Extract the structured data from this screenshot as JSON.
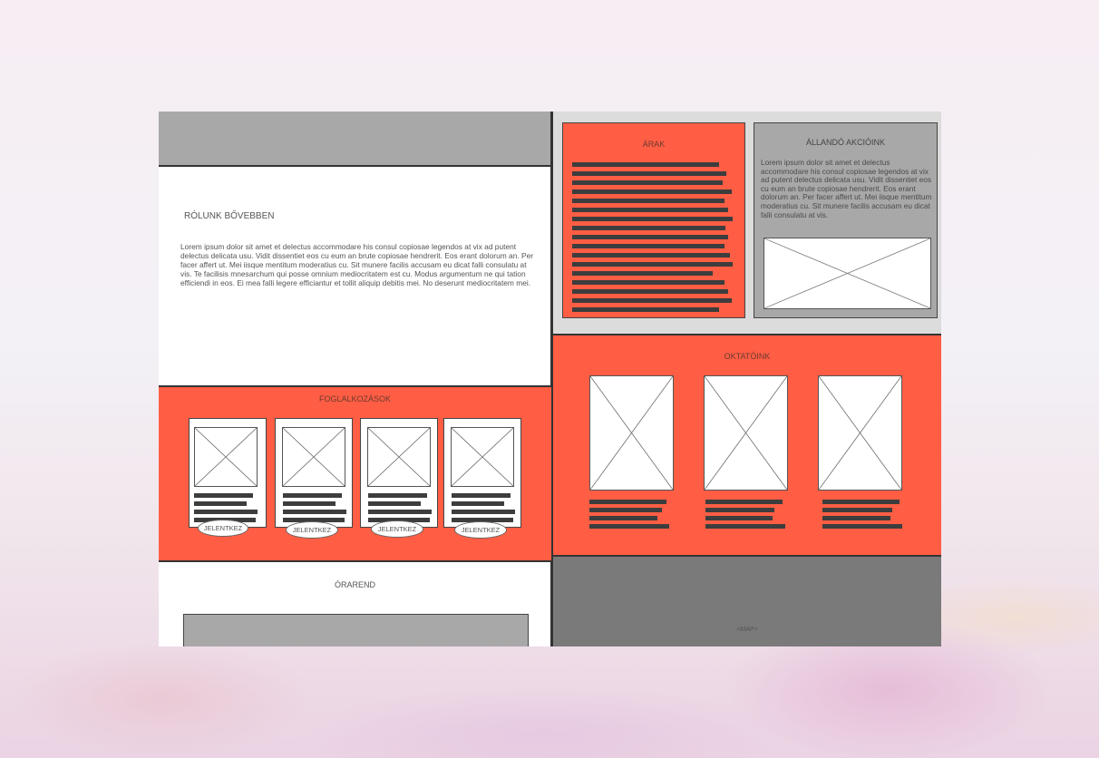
{
  "about": {
    "title": "RÓLUNK BŐVEBBEN",
    "text": "Lorem ipsum dolor sit amet et delectus accommodare his consul copiosae legendos at vix ad putent delectus delicata usu. Vidit dissentiet eos cu eum an brute copiosae hendrerit. Eos erant dolorum an. Per facer affert ut. Mei iisque mentitum moderatius cu. Sit munere facilis accusam eu dicat falli consulatu at vis. Te facilisis mnesarchum qui posse omnium mediocritatem est cu. Modus argumentum ne qui tation efficiendi in eos. Ei mea falli legere efficiantur et tollit aliquip debitis mei. No deserunt mediocritatem mei."
  },
  "activities": {
    "title": "FOGLALKOZÁSOK",
    "cards": [
      {
        "button": "JELENTKEZ",
        "image_icon": "image-placeholder-icon"
      },
      {
        "button": "JELENTKEZ",
        "image_icon": "image-placeholder-icon"
      },
      {
        "button": "JELENTKEZ",
        "image_icon": "image-placeholder-icon"
      },
      {
        "button": "JELENTKEZ",
        "image_icon": "image-placeholder-icon"
      }
    ]
  },
  "schedule": {
    "title": "ÓRAREND"
  },
  "prices": {
    "title": "ÁRAK"
  },
  "offers": {
    "title": "ÁLLANDÓ AKCIÓINK",
    "text": "Lorem ipsum dolor sit amet et delectus accommodare his consul copiosae legendos at vix ad putent delectus delicata usu. Vidit dissentiet eos cu eum an brute copiosae hendrerit. Eos erant dolorum an. Per facer affert ut. Mei iisque mentitum moderatius cu. Sit munere facilis accusam eu dicat falli consulatu at vis.",
    "image_icon": "image-placeholder-icon"
  },
  "instructors": {
    "title": "OKTATÓINK",
    "count": 3,
    "image_icon": "image-placeholder-icon"
  },
  "map": {
    "label": "<MAP>"
  },
  "colors": {
    "accent": "#ff5e44",
    "panel_gray": "#a8a8a8",
    "map_gray": "#7a7a7a",
    "text_bar": "#3d3d3d"
  }
}
